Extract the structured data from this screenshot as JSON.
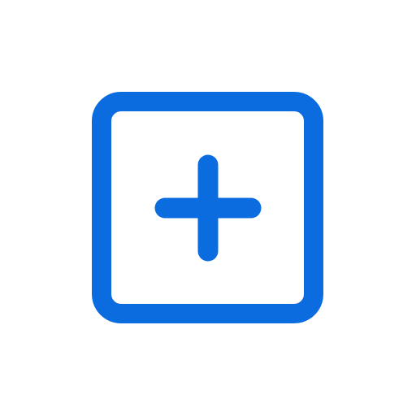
{
  "icon": {
    "name": "plus-square-icon",
    "color": "#0b6cdf",
    "background": "#ffffff"
  }
}
